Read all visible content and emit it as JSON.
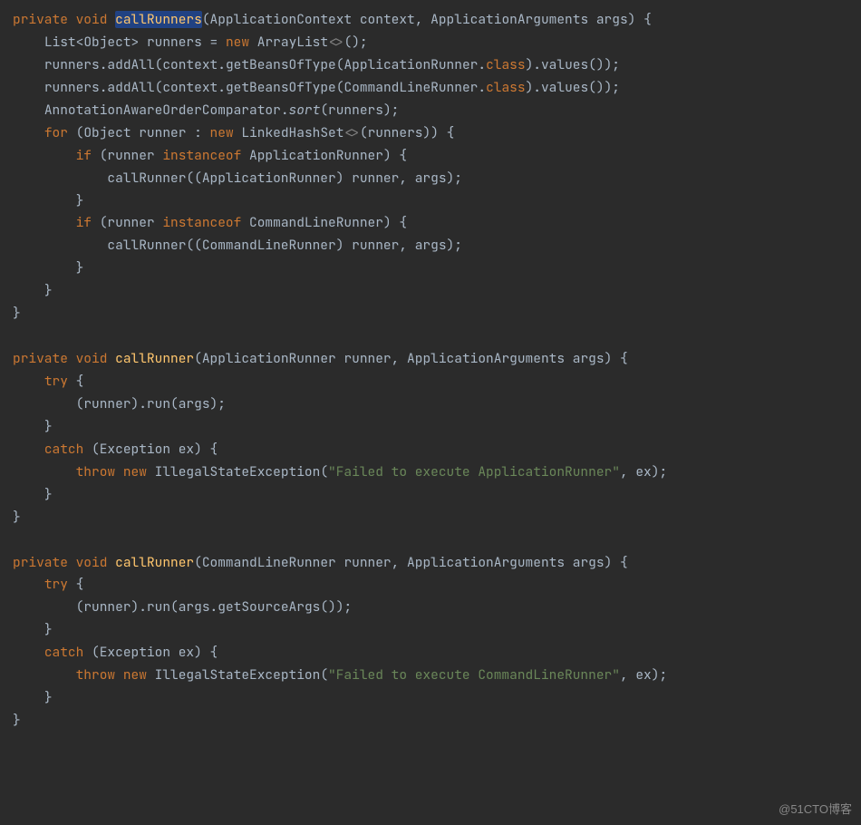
{
  "watermark": "@51CTO博客",
  "t": {
    "kw_private": "private",
    "kw_void": "void",
    "kw_new": "new",
    "kw_for": "for",
    "kw_if": "if",
    "kw_instanceof": "instanceof",
    "kw_try": "try",
    "kw_catch": "catch",
    "kw_throw": "throw",
    "kw_class": "class",
    "m_callRunners": "callRunners",
    "m_callRunner": "callRunner",
    "ApplicationContext": "ApplicationContext",
    "ApplicationArguments": "ApplicationArguments",
    "List": "List",
    "Object": "Object",
    "ArrayList": "ArrayList",
    "ApplicationRunner": "ApplicationRunner",
    "CommandLineRunner": "CommandLineRunner",
    "AnnotationAwareOrderComparator": "AnnotationAwareOrderComparator",
    "LinkedHashSet": "LinkedHashSet",
    "Exception": "Exception",
    "IllegalStateException": "IllegalStateException",
    "context": "context",
    "args": "args",
    "runners": "runners",
    "runner": "runner",
    "ex": "ex",
    "addAll": "addAll",
    "getBeansOfType": "getBeansOfType",
    "values": "values",
    "sort": "sort",
    "run": "run",
    "getSourceArgs": "getSourceArgs",
    "callRunnerCall": "callRunner",
    "str1": "\"Failed to execute ApplicationRunner\"",
    "str2": "\"Failed to execute CommandLineRunner\"",
    "diamond": "<>",
    "p_open": "(",
    "p_close": ")",
    "b_open": "{",
    "b_close": "}",
    "semi": ";",
    "comma": ", ",
    "dot": ".",
    "colon": " : ",
    "eq": " = ",
    "lt": "<",
    "gt": ">"
  }
}
